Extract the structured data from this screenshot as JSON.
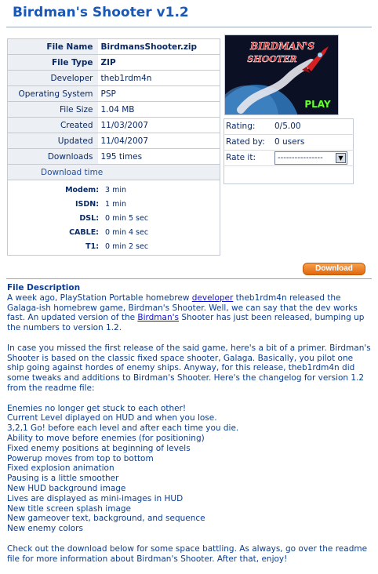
{
  "page": {
    "title": "Birdman's Shooter v1.2"
  },
  "info": {
    "rows": [
      {
        "label": "File Name",
        "value": "BirdmansShooter.zip"
      },
      {
        "label": "File Type",
        "value": "ZIP"
      },
      {
        "label": "Developer",
        "value": "theb1rdm4n"
      },
      {
        "label": "Operating System",
        "value": "PSP"
      },
      {
        "label": "File Size",
        "value": "1.04 MB"
      },
      {
        "label": "Created",
        "value": "11/03/2007"
      },
      {
        "label": "Updated",
        "value": "11/04/2007"
      },
      {
        "label": "Downloads",
        "value": "195 times"
      }
    ],
    "download_time_label": "Download time",
    "speeds": [
      {
        "label": "Modem:",
        "value": "3 min"
      },
      {
        "label": "ISDN:",
        "value": "1 min"
      },
      {
        "label": "DSL:",
        "value": "0 min 5 sec"
      },
      {
        "label": "CABLE:",
        "value": "0 min 4 sec"
      },
      {
        "label": "T1:",
        "value": "0 min 2 sec"
      }
    ]
  },
  "art": {
    "title_line1": "BIRDMAN'S",
    "title_line2": "SHOOTER",
    "play": "PLAY"
  },
  "rating": {
    "rating_label": "Rating:",
    "rating_value": "0/5.00",
    "rated_by_label": "Rated by:",
    "rated_by_value": "0 users",
    "rate_it_label": "Rate it:",
    "rate_select_value": "----------------"
  },
  "download_button": "Download",
  "description": {
    "heading": "File Description",
    "p1_a": "A week ago, PlayStation Portable homebrew ",
    "p1_link1": "developer",
    "p1_b": " theb1rdm4n released the Galaga-ish homebrew game, Birdman's Shooter. Well, we can say that the dev works fast. An updated version of the ",
    "p1_link2": "Birdman's",
    "p1_c": " Shooter has just been released, bumping up the numbers to version 1.2.",
    "p2": "In case you missed the first release of the said game, here's a bit of a primer. Birdman's Shooter is based on the classic fixed space shooter, Galaga. Basically, you pilot one ship going against hordes of enemy ships. Anyway, for this release, theb1rdm4n did some tweaks and additions to Birdman's Shooter. Here's the changelog for version 1.2 from the readme file:",
    "changelog": [
      "Enemies no longer get stuck to each other!",
      "Current Level diplayed on HUD and when you lose.",
      "3,2,1 Go! before each level and after each time you die.",
      "Ability to move before enemies (for positioning)",
      "Fixed enemy positions at beginning of levels",
      "Powerup moves from top to bottom",
      "Fixed explosion animation",
      "Pausing is a little smoother",
      "New HUD background image",
      "Lives are displayed as mini-images in HUD",
      "New title screen splash image",
      "New gameover text, background, and sequence",
      "New enemy colors"
    ],
    "p3": "Check out the download below for some space battling. As always, go over the readme file for more information about Birdman's Shooter. After that, enjoy!"
  }
}
